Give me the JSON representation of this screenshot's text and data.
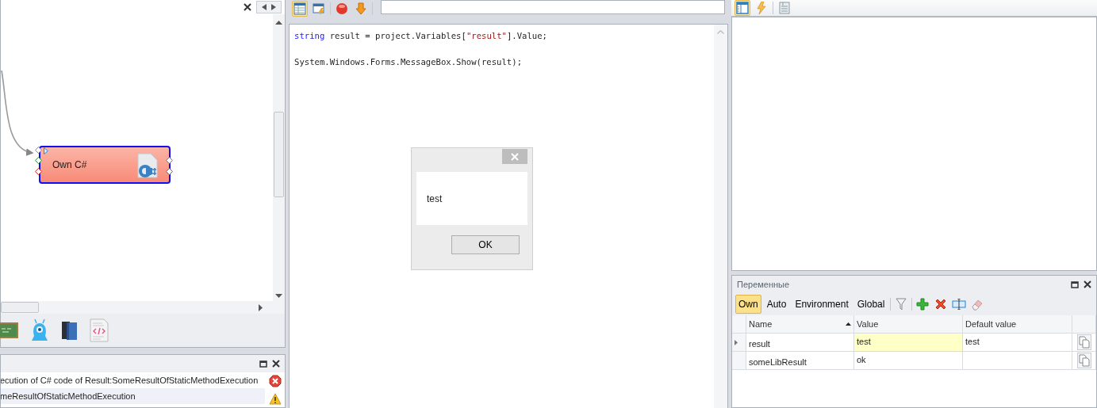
{
  "canvas": {
    "nodes": [
      {
        "label": "Own C#",
        "selected": true
      }
    ]
  },
  "log": {
    "entries": [
      {
        "text": "ecution of C# code of  Result:SomeResultOfStaticMethodExecution",
        "kind": "error",
        "selected": false
      },
      {
        "text": "meResultOfStaticMethodExecution",
        "kind": "warning",
        "selected": true
      }
    ]
  },
  "editor": {
    "lines": [
      [
        {
          "text": "string",
          "kind": "keyword"
        },
        {
          "text": " result = project.Variables[",
          "kind": "plain"
        },
        {
          "text": "\"result\"",
          "kind": "string"
        },
        {
          "text": "].Value;",
          "kind": "plain"
        }
      ],
      [
        {
          "text": "System.Windows.Forms.MessageBox.Show(result);",
          "kind": "plain"
        }
      ]
    ]
  },
  "dialog": {
    "message": "test",
    "buttons": [
      "OK"
    ]
  },
  "variables": {
    "title": "Переменные",
    "filters": [
      {
        "label": "Own",
        "selected": true
      },
      {
        "label": "Auto",
        "selected": false
      },
      {
        "label": "Environment",
        "selected": false
      },
      {
        "label": "Global",
        "selected": false
      }
    ],
    "columns": [
      {
        "label": "Name",
        "sorted": true
      },
      {
        "label": "Value",
        "sorted": false
      },
      {
        "label": "Default value",
        "sorted": false
      }
    ],
    "rows": [
      {
        "name": "result",
        "value": "test",
        "default": "test",
        "selected": true
      },
      {
        "name": "someLibResult",
        "value": "ok",
        "selected": false
      }
    ]
  }
}
